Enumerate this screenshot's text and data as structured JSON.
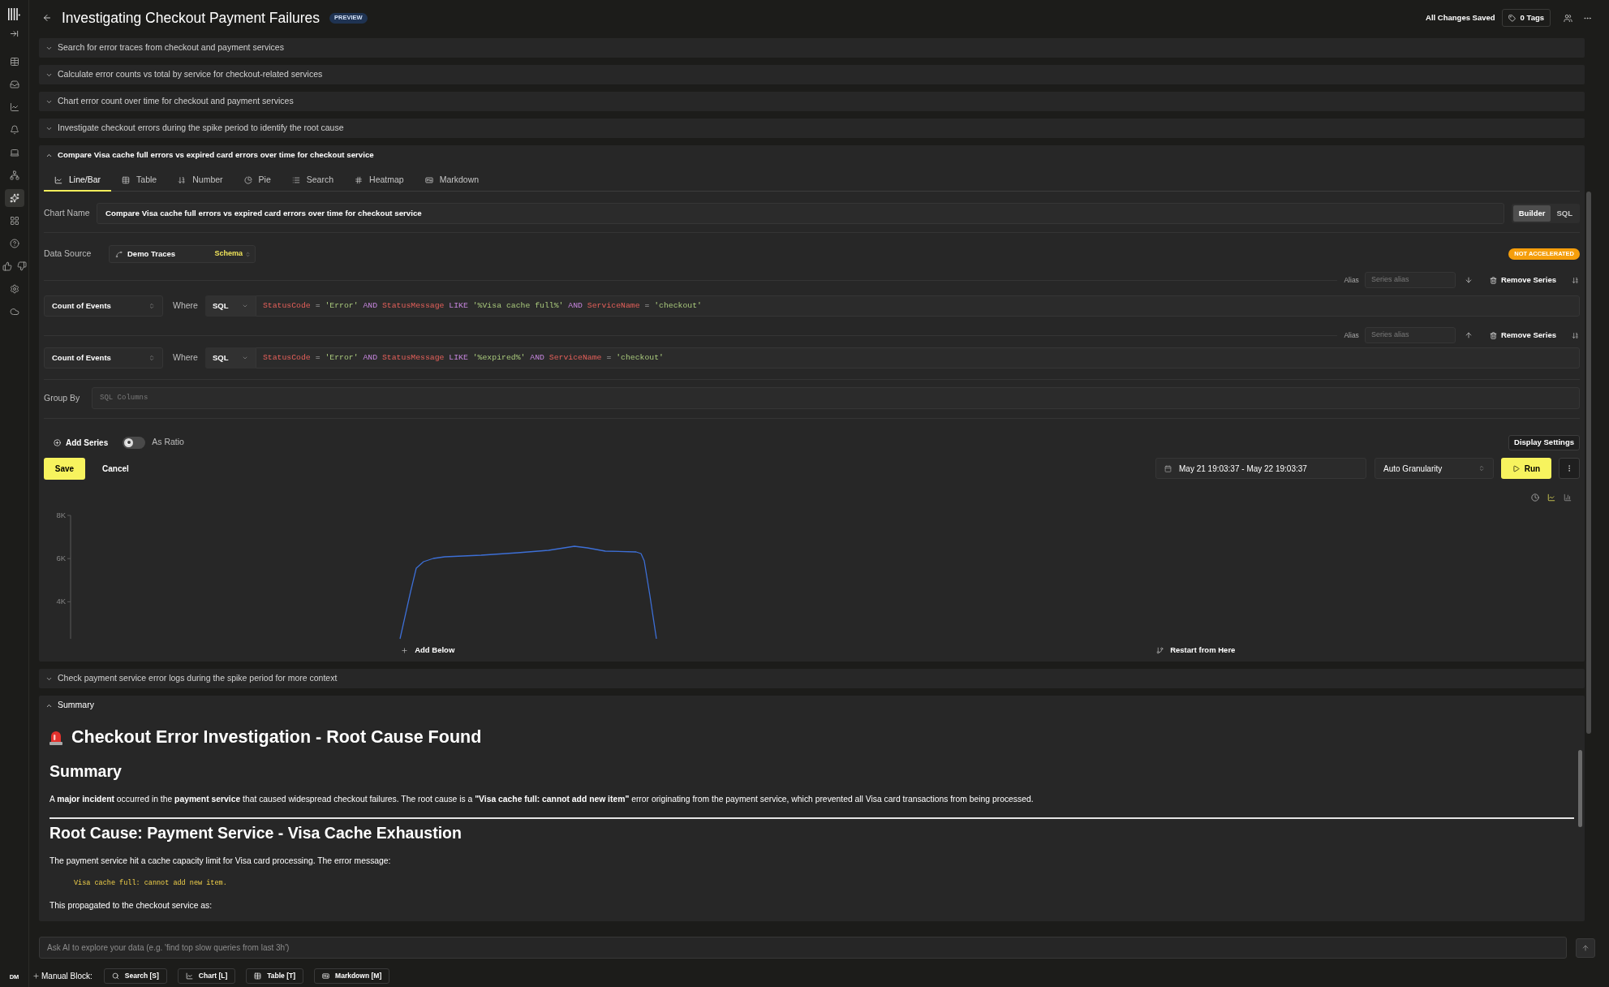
{
  "sidebar": {
    "items": [
      {
        "kind": "table",
        "selected": false
      },
      {
        "kind": "inbox",
        "selected": false
      },
      {
        "kind": "chart",
        "selected": false
      },
      {
        "kind": "bell",
        "selected": false
      },
      {
        "kind": "laptop",
        "selected": false
      },
      {
        "kind": "network",
        "selected": false
      },
      {
        "kind": "sparkles",
        "selected": true
      },
      {
        "kind": "grid",
        "selected": false
      },
      {
        "kind": "help",
        "selected": false
      },
      {
        "kind": "thumbs_up",
        "selected": false
      },
      {
        "kind": "thumbs_down",
        "selected": false
      },
      {
        "kind": "settings",
        "selected": false
      },
      {
        "kind": "cloud",
        "selected": false
      }
    ],
    "avatar": "DM"
  },
  "header": {
    "title": "Investigating Checkout Payment Failures",
    "badge": "PREVIEW",
    "save_status": "All Changes Saved",
    "tags_button": "0 Tags"
  },
  "cells": [
    {
      "kind": "collapsed",
      "title": "Search for error traces from checkout and payment services",
      "expanded": false
    },
    {
      "kind": "collapsed",
      "title": "Calculate error counts vs total by service for checkout-related services",
      "expanded": false
    },
    {
      "kind": "collapsed",
      "title": "Chart error count over time for checkout and payment services",
      "expanded": false
    },
    {
      "kind": "collapsed",
      "title": "Investigate checkout errors during the spike period to identify the root cause",
      "expanded": false
    },
    {
      "kind": "chart",
      "title": "Compare Visa cache full errors vs expired card errors over time for checkout service",
      "expanded": true,
      "tabs": [
        {
          "kind": "line",
          "label": "Line/Bar",
          "selected": true
        },
        {
          "kind": "table",
          "label": "Table",
          "selected": false
        },
        {
          "kind": "number",
          "label": "Number",
          "selected": false
        },
        {
          "kind": "pie",
          "label": "Pie",
          "selected": false
        },
        {
          "kind": "search",
          "label": "Search",
          "selected": false
        },
        {
          "kind": "heatmap",
          "label": "Heatmap",
          "selected": false
        },
        {
          "kind": "markdown",
          "label": "Markdown",
          "selected": false
        }
      ],
      "chart_name": {
        "label": "Chart Name",
        "value": "Compare Visa cache full errors vs expired card errors over time for checkout service"
      },
      "modes": [
        {
          "label": "Builder",
          "selected": true
        },
        {
          "label": "SQL",
          "selected": false
        }
      ],
      "data_source": {
        "label": "Data Source",
        "value": "Demo Traces",
        "schema_button": "Schema"
      },
      "acceleration_badge": "NOT ACCELERATED",
      "series": [
        {
          "alias_label": "Alias",
          "alias_placeholder": "Series alias",
          "move_up": false,
          "remove_button": "Remove Series",
          "aggregation": "Count of Events",
          "where_label": "Where",
          "language": "SQL",
          "condition": "StatusCode = 'Error' AND StatusMessage LIKE '%Visa cache full%' AND ServiceName = 'checkout'"
        },
        {
          "alias_label": "Alias",
          "alias_placeholder": "Series alias",
          "move_up": true,
          "remove_button": "Remove Series",
          "aggregation": "Count of Events",
          "where_label": "Where",
          "language": "SQL",
          "condition": "StatusCode = 'Error' AND StatusMessage LIKE '%expired%' AND ServiceName = 'checkout'"
        }
      ],
      "group_by": {
        "label": "Group By",
        "placeholder": "SQL Columns"
      },
      "add_series_button": "Add Series",
      "as_ratio": {
        "label": "As Ratio",
        "on": false
      },
      "display_settings_button": "Display Settings",
      "save_button": "Save",
      "cancel_button": "Cancel",
      "time_range": "May 21 19:03:37 - May 22 19:03:37",
      "granularity": "Auto Granularity",
      "run_button": "Run",
      "display_types": [
        {
          "kind": "line",
          "selected": true
        },
        {
          "kind": "bar",
          "selected": false
        }
      ],
      "chart": {
        "y_tick_labels": [
          "8K",
          "6K",
          "4K"
        ]
      },
      "add_below_button": "Add Below",
      "restart_button": "Restart from Here"
    },
    {
      "kind": "collapsed",
      "title": "Check payment service error logs during the spike period for more context",
      "expanded": false
    },
    {
      "kind": "markdown",
      "title": "Summary",
      "expanded": true,
      "blocks": [
        {
          "kind": "h1",
          "has_icon": true,
          "text": "Checkout Error Investigation - Root Cause Found"
        },
        {
          "kind": "h2",
          "text": "Summary"
        },
        {
          "kind": "p",
          "text": "A **major incident** occurred in the **payment service** that caused widespread checkout failures. The root cause is a **\"Visa cache full: cannot add new item\"** error originating from the payment service, which prevented all Visa card transactions from being processed."
        },
        {
          "kind": "hr"
        },
        {
          "kind": "h2",
          "text": "Root Cause: Payment Service - Visa Cache Exhaustion"
        },
        {
          "kind": "p",
          "text": "The payment service hit a cache capacity limit for Visa card processing. The error message:"
        },
        {
          "kind": "code",
          "text": "Visa cache full: cannot add new item."
        },
        {
          "kind": "p",
          "text": "This propagated to the checkout service as:"
        }
      ]
    }
  ],
  "ai_input": {
    "placeholder": "Ask AI to explore your data (e.g. 'find top slow queries from last 3h')"
  },
  "manual_block": {
    "label": "Manual Block:",
    "buttons": [
      {
        "kind": "search",
        "label": "Search [S]"
      },
      {
        "kind": "chart",
        "label": "Chart [L]"
      },
      {
        "kind": "table",
        "label": "Table [T]"
      },
      {
        "kind": "markdown",
        "label": "Markdown [M]"
      }
    ]
  }
}
